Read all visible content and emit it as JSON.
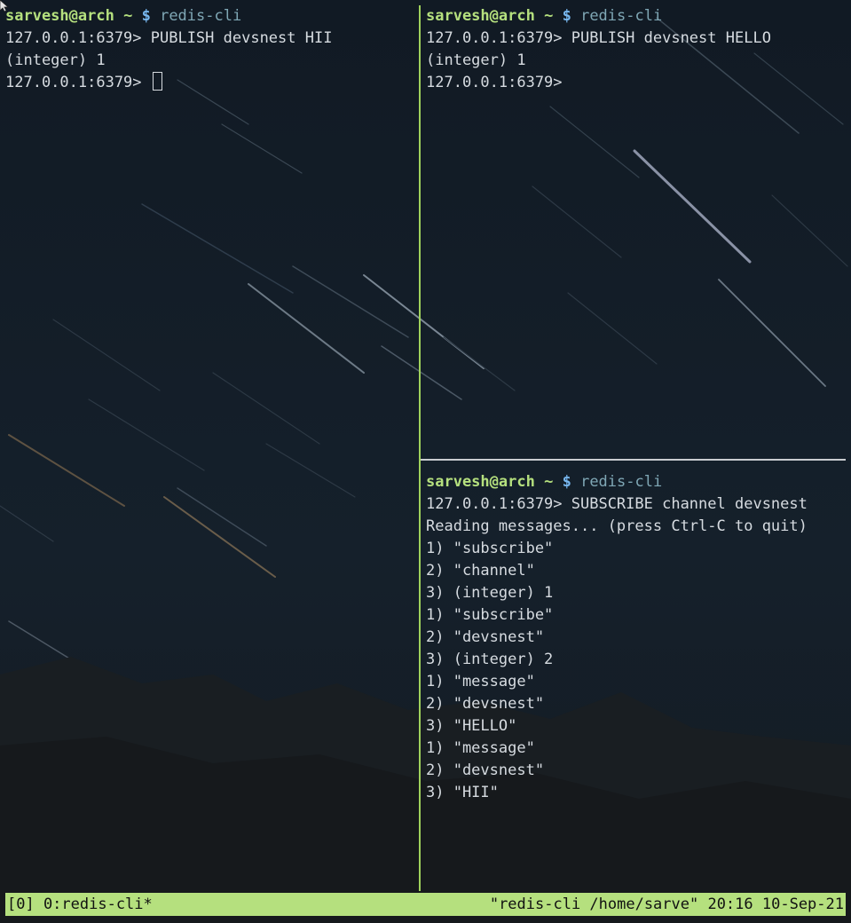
{
  "colors": {
    "prompt_user": "#b5e07e",
    "prompt_dollar": "#78b8f0",
    "command": "#7fa7b5",
    "output": "#d6dbe0",
    "pane_border": "#9fd25c",
    "status_bar": "#b5e07e"
  },
  "panes": {
    "left": {
      "prompt": {
        "user": "sarvesh@arch",
        "tilde": "~",
        "dollar": "$",
        "command": "redis-cli"
      },
      "lines": [
        "127.0.0.1:6379> PUBLISH devsnest HII",
        "(integer) 1",
        "127.0.0.1:6379> "
      ]
    },
    "right_top": {
      "prompt": {
        "user": "sarvesh@arch",
        "tilde": "~",
        "dollar": "$",
        "command": "redis-cli"
      },
      "lines": [
        "127.0.0.1:6379> PUBLISH devsnest HELLO",
        "(integer) 1",
        "127.0.0.1:6379>"
      ]
    },
    "right_bottom": {
      "prompt": {
        "user": "sarvesh@arch",
        "tilde": "~",
        "dollar": "$",
        "command": "redis-cli"
      },
      "lines": [
        "127.0.0.1:6379> SUBSCRIBE channel devsnest",
        "Reading messages... (press Ctrl-C to quit)",
        "1) \"subscribe\"",
        "2) \"channel\"",
        "3) (integer) 1",
        "1) \"subscribe\"",
        "2) \"devsnest\"",
        "3) (integer) 2",
        "1) \"message\"",
        "2) \"devsnest\"",
        "3) \"HELLO\"",
        "1) \"message\"",
        "2) \"devsnest\"",
        "3) \"HII\""
      ]
    }
  },
  "status_bar": {
    "left": "[0] 0:redis-cli*",
    "right": "\"redis-cli /home/sarve\" 20:16 10-Sep-21"
  }
}
